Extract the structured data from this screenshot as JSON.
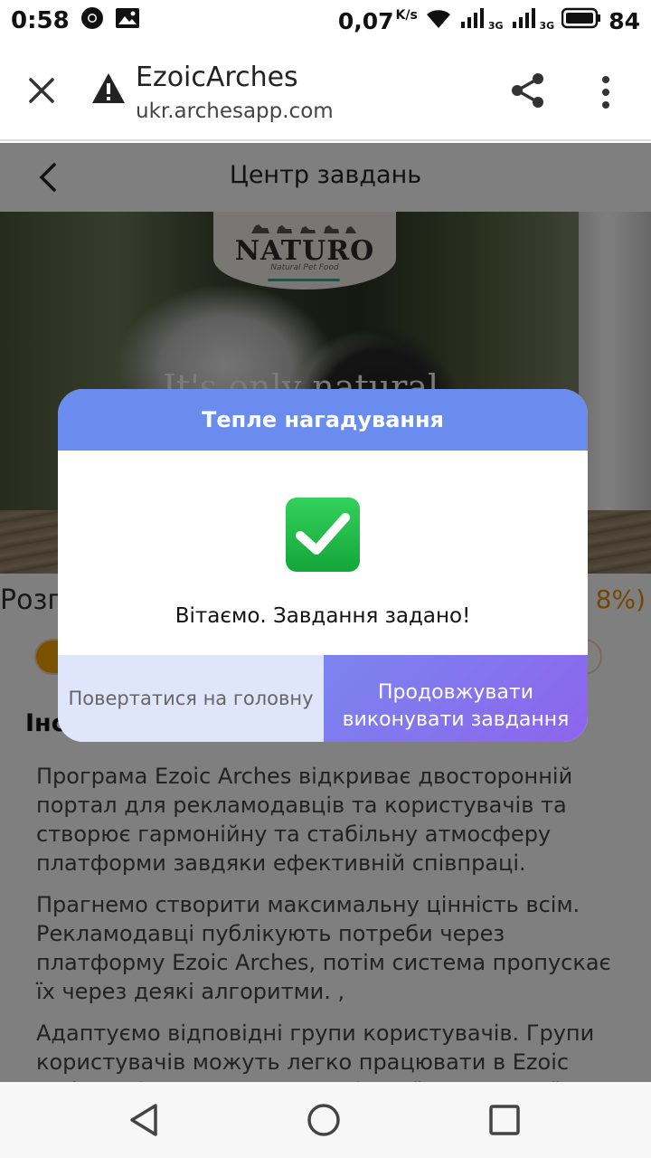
{
  "status_bar": {
    "time": "0:58",
    "speed": "0,07",
    "speed_unit": "K/s",
    "battery": "84",
    "network_1": "3G",
    "network_2": "3G"
  },
  "browser": {
    "title": "EzoicArches",
    "url": "ukr.archesapp.com"
  },
  "page": {
    "title": "Центр завдань",
    "banner": {
      "brand": "NATURO",
      "brand_tagline": "Natural Pet Food",
      "overlay_text": "It's only natural"
    },
    "progress": {
      "label": "Розп",
      "value_text": "8%)",
      "fraction": 0.08
    },
    "section_heading": "Інс",
    "paragraphs": [
      "Програма Ezoic Arches відкриває двосторонній портал для рекламодавців та користувачів та створює гармонійну та стабільну атмосферу платформи завдяки ефективній співпраці.",
      "Прагнемо створити максимальну цінність всім. Рекламодавці публікують потреби через платформу Ezoic Arches, потім система пропускає їх через деякі алгоритми.  ,",
      "Адаптуємо відповідні групи користувачів. Групи користувачів можуть легко працювати в Ezoic Arches, підключаючись до кілької завершеної"
    ]
  },
  "modal": {
    "title": "Тепле нагадування",
    "message": "Вітаємо. Завдання задано!",
    "home_button": "Повертатися на головну",
    "continue_button": "Продовжувати виконувати завдання"
  },
  "colors": {
    "modal_header": "#6a8cee",
    "continue_button": "#8d64ec",
    "home_button": "#dfe5fa",
    "check_green": "#14a63a",
    "progress_orange": "#f5a300"
  }
}
